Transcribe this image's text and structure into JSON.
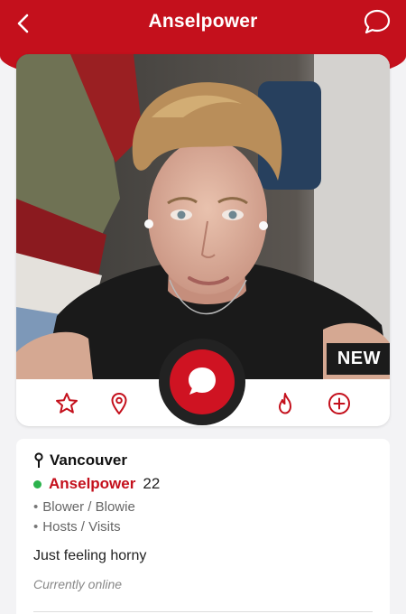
{
  "header": {
    "title": "Anselpower",
    "back_icon": "chevron-left-icon",
    "chat_icon": "speech-bubble-icon"
  },
  "profile": {
    "badge": "NEW",
    "location": "Vancouver",
    "username": "Anselpower",
    "age": "22",
    "online_indicator_color": "#2bb24c",
    "tags": [
      "Blower / Blowie",
      "Hosts / Visits"
    ],
    "status_message": "Just feeling horny",
    "presence": "Currently online"
  },
  "actions": {
    "favorite_icon": "star-icon",
    "location_icon": "map-pin-icon",
    "message_icon": "message-bubble-icon",
    "hot_icon": "flame-icon",
    "add_icon": "plus-circle-icon"
  },
  "colors": {
    "brand": "#c4101c",
    "header_text": "#ffffff"
  }
}
